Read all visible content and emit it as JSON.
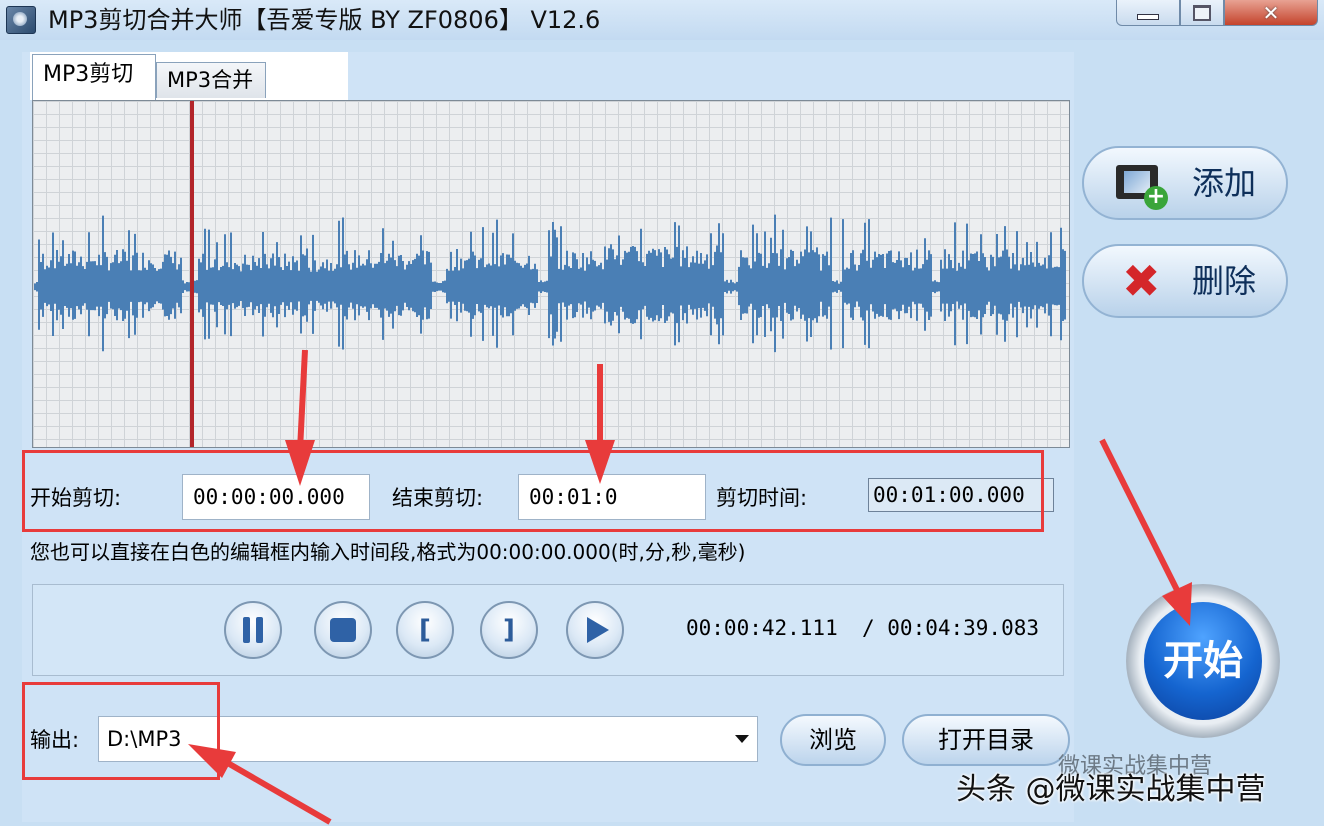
{
  "window": {
    "title": "MP3剪切合并大师【吾爱专版 BY ZF0806】 V12.6",
    "controls": {
      "minimize": "minimize",
      "maximize": "maximize",
      "close": "✕"
    }
  },
  "tabs": [
    {
      "label": "MP3剪切",
      "active": true
    },
    {
      "label": "MP3合并",
      "active": false
    }
  ],
  "cut": {
    "start_label": "开始剪切:",
    "start_value": "00:00:00.000",
    "end_label": "结束剪切:",
    "end_value": "00:01:0",
    "duration_label": "剪切时间:",
    "duration_value": "00:01:00.000"
  },
  "hint": "您也可以直接在白色的编辑框内输入时间段,格式为00:00:00.000(时,分,秒,毫秒)",
  "player": {
    "current_time": "00:00:42.111",
    "total_time": "/ 00:04:39.083",
    "buttons": [
      "pause",
      "stop",
      "mark-in",
      "mark-out",
      "play-selection"
    ]
  },
  "output": {
    "label": "输出:",
    "path": "D:\\MP3",
    "browse_label": "浏览",
    "open_dir_label": "打开目录"
  },
  "side": {
    "add_label": "添加",
    "delete_label": "删除",
    "start_label": "开始"
  },
  "watermark": {
    "main": "头条 @微课实战集中营",
    "ghost": "微课实战集中营"
  },
  "colors": {
    "window_bg": "#c8dff3",
    "waveform": "#4a7fb5",
    "cursor": "#b3252a",
    "annotation": "#e83b3b",
    "start_button": "#1565d0"
  }
}
